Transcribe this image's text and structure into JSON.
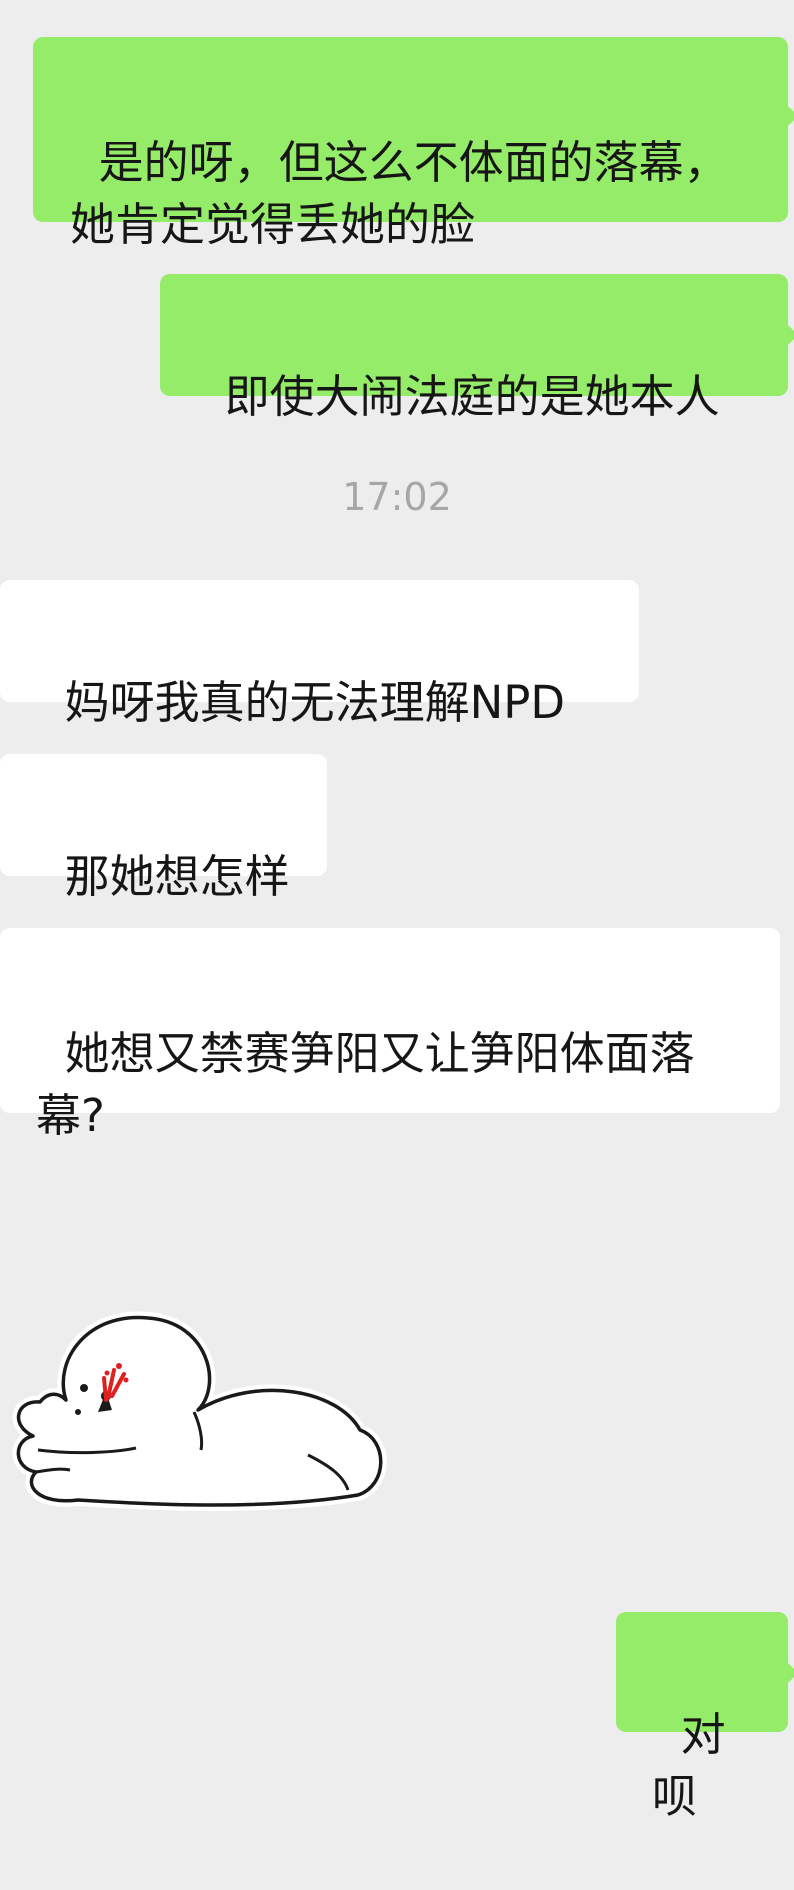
{
  "chat": {
    "messages": [
      {
        "side": "sent",
        "text": "是的呀，但这么不体面的落幕，\n她肯定觉得丢她的脸"
      },
      {
        "side": "sent",
        "text": "即使大闹法庭的是她本人"
      },
      {
        "side": "recv",
        "text": "妈呀我真的无法理解NPD"
      },
      {
        "side": "recv",
        "text": "那她想怎样"
      },
      {
        "side": "recv",
        "text": "她想又禁赛笋阳又让笋阳体面落\n幕?"
      },
      {
        "side": "recv",
        "sticker": "crying-blob-sticker"
      },
      {
        "side": "sent",
        "text": "对呗"
      }
    ],
    "timestamp": "17:02"
  },
  "colors": {
    "background": "#ededed",
    "sent_bubble": "#95ec69",
    "received_bubble": "#ffffff",
    "timestamp_text": "#a6a6a6"
  }
}
